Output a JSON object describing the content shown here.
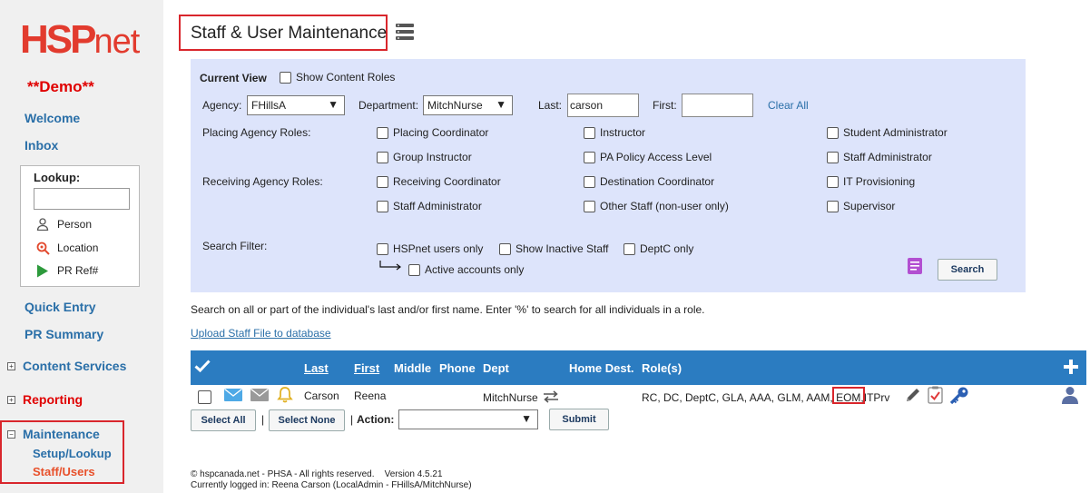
{
  "sidebar": {
    "logo_main": "HSP",
    "logo_suffix": "net",
    "demo": "**Demo**",
    "welcome": "Welcome",
    "inbox": "Inbox",
    "lookup": {
      "label": "Lookup:",
      "person": "Person",
      "location": "Location",
      "pr_ref": "PR Ref#"
    },
    "quick_entry": "Quick Entry",
    "pr_summary": "PR Summary",
    "content_services": "Content Services",
    "reporting": "Reporting",
    "maintenance": "Maintenance",
    "setup_lookup": "Setup/Lookup",
    "staff_users": "Staff/Users",
    "colors": {
      "link": "#2a6fa8",
      "red": "#e00000",
      "active": "#e8502a"
    }
  },
  "page": {
    "title": "Staff & User Maintenance"
  },
  "filters": {
    "current_view": "Current View",
    "show_content_roles": "Show Content Roles",
    "agency_label": "Agency:",
    "agency_value": "FHillsA",
    "department_label": "Department:",
    "department_value": "MitchNurse",
    "last_label": "Last:",
    "last_value": "carson",
    "first_label": "First:",
    "first_value": "",
    "clear_all": "Clear All",
    "placing_roles_label": "Placing Agency Roles:",
    "receiving_roles_label": "Receiving Agency Roles:",
    "roles": {
      "placing_coordinator": "Placing Coordinator",
      "instructor": "Instructor",
      "student_administrator": "Student Administrator",
      "group_instructor": "Group Instructor",
      "pa_policy": "PA Policy Access Level",
      "staff_administrator_1": "Staff Administrator",
      "receiving_coordinator": "Receiving Coordinator",
      "destination_coordinator": "Destination Coordinator",
      "it_provisioning": "IT Provisioning",
      "staff_administrator_2": "Staff Administrator",
      "other_staff": "Other Staff (non-user only)",
      "supervisor": "Supervisor"
    },
    "search_filter_label": "Search Filter:",
    "hspnet_users_only": "HSPnet users only",
    "show_inactive": "Show Inactive Staff",
    "deptc_only": "DeptC only",
    "active_accounts": "Active accounts only",
    "search_button": "Search"
  },
  "hint": "Search on all or part of the individual's last and/or first name. Enter '%' to search for all individuals in a role.",
  "upload_link": "Upload Staff File to database",
  "grid": {
    "headers": {
      "last": "Last",
      "first": "First",
      "middle": "Middle",
      "phone": "Phone",
      "dept": "Dept",
      "home_dest": "Home Dest.",
      "roles": "Role(s)"
    },
    "rows": [
      {
        "last": "Carson",
        "first": "Reena",
        "dept": "MitchNurse",
        "roles_prefix": "RC, DC, DeptC, GLA, AAA, GLM, AAM,",
        "roles_highlight": "EOM,",
        "roles_suffix": "ITPrv"
      }
    ],
    "header_color": "#2b7cc1"
  },
  "actions": {
    "select_all": "Select All",
    "select_none": "Select None",
    "separator": "|",
    "action_label": "Action:",
    "action_value": "",
    "submit": "Submit"
  },
  "footer": {
    "line1": "© hspcanada.net - PHSA - All rights reserved.    Version 4.5.21",
    "line2": "Currently logged in: Reena Carson (LocalAdmin - FHillsA/MitchNurse)"
  }
}
